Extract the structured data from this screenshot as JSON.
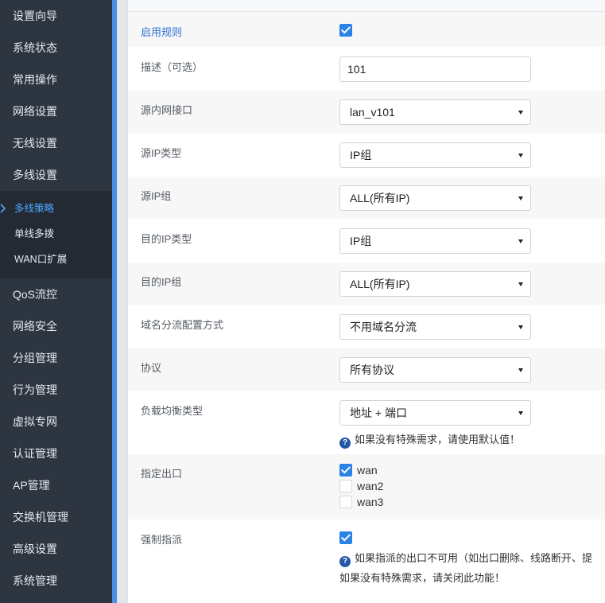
{
  "sidebar": {
    "items_top": [
      {
        "label": "设置向导"
      },
      {
        "label": "系统状态"
      },
      {
        "label": "常用操作"
      },
      {
        "label": "网络设置"
      },
      {
        "label": "无线设置"
      },
      {
        "label": "多线设置"
      }
    ],
    "submenu": [
      {
        "label": "多线策略",
        "active": true
      },
      {
        "label": "单线多拨"
      },
      {
        "label": "WAN口扩展"
      }
    ],
    "items_bottom": [
      {
        "label": "QoS流控"
      },
      {
        "label": "网络安全"
      },
      {
        "label": "分组管理"
      },
      {
        "label": "行为管理"
      },
      {
        "label": "虚拟专网"
      },
      {
        "label": "认证管理"
      },
      {
        "label": "AP管理"
      },
      {
        "label": "交换机管理"
      },
      {
        "label": "高级设置"
      },
      {
        "label": "系统管理"
      }
    ]
  },
  "form": {
    "enable_rule": {
      "label": "启用规则",
      "checked": true
    },
    "description": {
      "label": "描述（可选）",
      "value": "101"
    },
    "src_interface": {
      "label": "源内网接口",
      "value": "lan_v101"
    },
    "src_ip_type": {
      "label": "源IP类型",
      "value": "IP组"
    },
    "src_ip_group": {
      "label": "源IP组",
      "value": "ALL(所有IP)"
    },
    "dst_ip_type": {
      "label": "目的IP类型",
      "value": "IP组"
    },
    "dst_ip_group": {
      "label": "目的IP组",
      "value": "ALL(所有IP)"
    },
    "domain_mode": {
      "label": "域名分流配置方式",
      "value": "不用域名分流"
    },
    "protocol": {
      "label": "协议",
      "value": "所有协议"
    },
    "lb_type": {
      "label": "负载均衡类型",
      "value": "地址 + 端口",
      "hint": "如果没有特殊需求，请使用默认值！"
    },
    "egress": {
      "label": "指定出口",
      "options": [
        {
          "label": "wan",
          "checked": true
        },
        {
          "label": "wan2",
          "checked": false
        },
        {
          "label": "wan3",
          "checked": false
        }
      ]
    },
    "force": {
      "label": "强制指派",
      "checked": true,
      "hint_line1": "如果指派的出口不可用（如出口删除、线路断开、提",
      "hint_line2": "如果没有特殊需求，请关闭此功能！"
    }
  },
  "colors": {
    "sidebar_bg": "#2d3541",
    "accent": "#2b83e8",
    "active_nav": "#4da6ff",
    "label_primary": "#2d6fd1"
  },
  "icons": {
    "checkbox": "check-icon",
    "select_arrow": "caret-down-icon",
    "help": "question-circle-icon",
    "nav_active": "chevron-right-icon"
  }
}
